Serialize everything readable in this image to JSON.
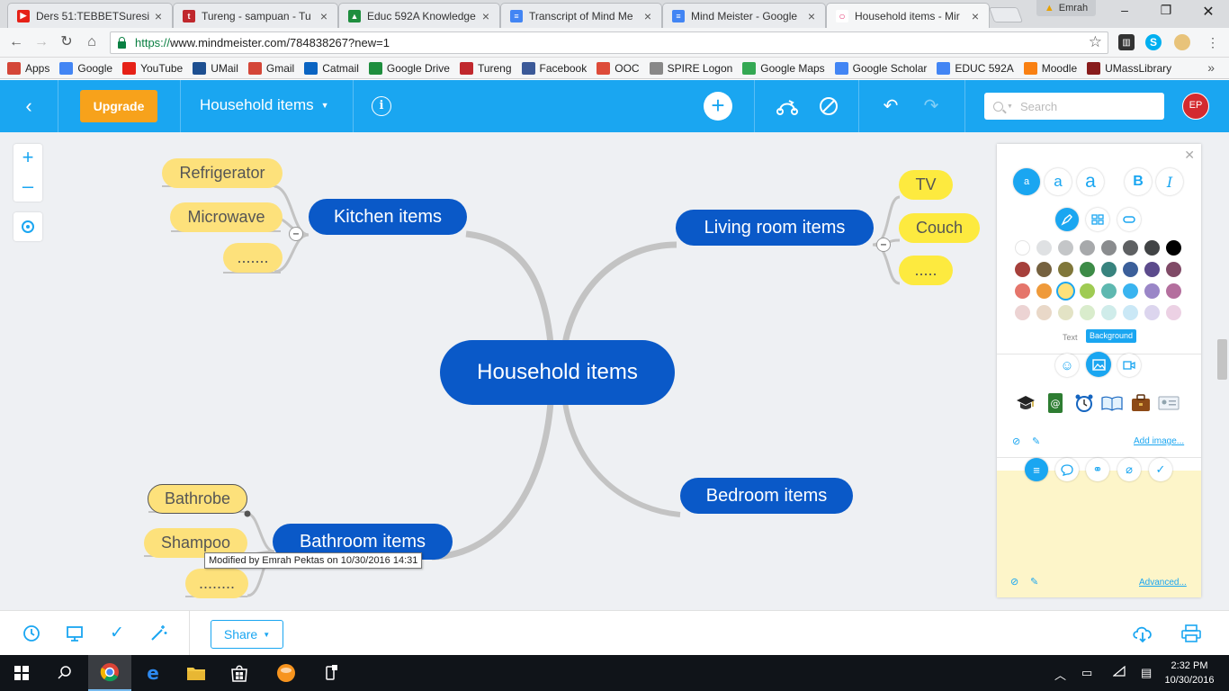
{
  "browser": {
    "tabs": [
      {
        "title": "Ders 51:TEBBETSuresi",
        "icon_color": "#e62117",
        "icon_glyph": "▶",
        "active": false
      },
      {
        "title": "Tureng - sampuan - Tu",
        "icon_color": "#c0282d",
        "icon_glyph": "t",
        "active": false
      },
      {
        "title": "Educ 592A Knowledge",
        "icon_color": "#1e8e3e",
        "icon_glyph": "▲",
        "active": false
      },
      {
        "title": "Transcript of Mind Me",
        "icon_color": "#4285f4",
        "icon_glyph": "≡",
        "active": false
      },
      {
        "title": "Mind Meister - Google",
        "icon_color": "#4285f4",
        "icon_glyph": "≡",
        "active": false
      },
      {
        "title": "Household items - Mir",
        "icon_color": "#e5407a",
        "icon_glyph": "○",
        "active": true
      }
    ],
    "profile_name": "Emrah",
    "url_scheme": "https://",
    "url_rest": "www.mindmeister.com/784838267?new=1",
    "bookmarks": [
      {
        "label": "Apps",
        "icon": "apps-icon",
        "color": "#d44638"
      },
      {
        "label": "Google",
        "icon": "google-icon",
        "color": "#4285f4"
      },
      {
        "label": "YouTube",
        "icon": "youtube-icon",
        "color": "#e62117"
      },
      {
        "label": "UMail",
        "icon": "umail-icon",
        "color": "#1d4f91"
      },
      {
        "label": "Gmail",
        "icon": "gmail-icon",
        "color": "#d44638"
      },
      {
        "label": "Catmail",
        "icon": "catmail-icon",
        "color": "#0a64c2"
      },
      {
        "label": "Google Drive",
        "icon": "drive-icon",
        "color": "#1e8e3e"
      },
      {
        "label": "Tureng",
        "icon": "tureng-icon",
        "color": "#c0282d"
      },
      {
        "label": "Facebook",
        "icon": "facebook-icon",
        "color": "#3b5998"
      },
      {
        "label": "OOC",
        "icon": "gplus-icon",
        "color": "#dd4b39"
      },
      {
        "label": "SPIRE Logon",
        "icon": "page-icon",
        "color": "#888888"
      },
      {
        "label": "Google Maps",
        "icon": "maps-icon",
        "color": "#34a853"
      },
      {
        "label": "Google Scholar",
        "icon": "scholar-icon",
        "color": "#4285f4"
      },
      {
        "label": "EDUC 592A",
        "icon": "doc-icon",
        "color": "#4285f4"
      },
      {
        "label": "Moodle",
        "icon": "moodle-icon",
        "color": "#f98012"
      },
      {
        "label": "UMassLibrary",
        "icon": "umass-icon",
        "color": "#881c1c"
      }
    ]
  },
  "toolbar": {
    "upgrade_label": "Upgrade",
    "map_title": "Household items",
    "search_placeholder": "Search",
    "avatar_initials": "EP",
    "accent": "#1aa6f1"
  },
  "mindmap": {
    "central": "Household items",
    "branches": [
      {
        "id": "kitchen",
        "label": "Kitchen items",
        "children": [
          "Refrigerator",
          "Microwave",
          "......."
        ]
      },
      {
        "id": "living",
        "label": "Living room items",
        "children": [
          "TV",
          "Couch",
          "....."
        ]
      },
      {
        "id": "bathroom",
        "label": "Bathroom items",
        "children": [
          "Bathrobe",
          "Shampoo",
          "........"
        ]
      },
      {
        "id": "bedroom",
        "label": "Bedroom items",
        "children": []
      }
    ],
    "node_color": "#0a59c8",
    "leaf_color": "#fde17b",
    "tooltip": "Modified by Emrah Pektas on 10/30/2016 14:31"
  },
  "panel": {
    "font_size_buttons": [
      "a",
      "a",
      "a"
    ],
    "bold_label": "B",
    "italic_label": "I",
    "colors": [
      [
        "#ffffff",
        "#dfe1e3",
        "#c4c6c8",
        "#a7a9ab",
        "#8a8c8e",
        "#5e6062",
        "#414345",
        "#000000"
      ],
      [
        "#a6403b",
        "#75613f",
        "#80773a",
        "#3d8b47",
        "#38837e",
        "#3b5f9a",
        "#5c4b8c",
        "#804a67"
      ],
      [
        "#e5756b",
        "#ef9a3a",
        "#fde17b",
        "#9fcb53",
        "#5eb8b0",
        "#39b4f0",
        "#9a86c7",
        "#b46f9e"
      ],
      [
        "#ecd3d3",
        "#e9d8c8",
        "#e3e3c5",
        "#d9eccc",
        "#cfecea",
        "#cae8f6",
        "#dcd5ee",
        "#ecd1e4"
      ]
    ],
    "selected_color": "#fde17b",
    "text_tab_label": "Text",
    "background_tab_label": "Background",
    "add_image_label": "Add image...",
    "advanced_label": "Advanced..."
  },
  "bottom": {
    "share_label": "Share"
  },
  "taskbar": {
    "time": "2:32 PM",
    "date": "10/30/2016"
  }
}
